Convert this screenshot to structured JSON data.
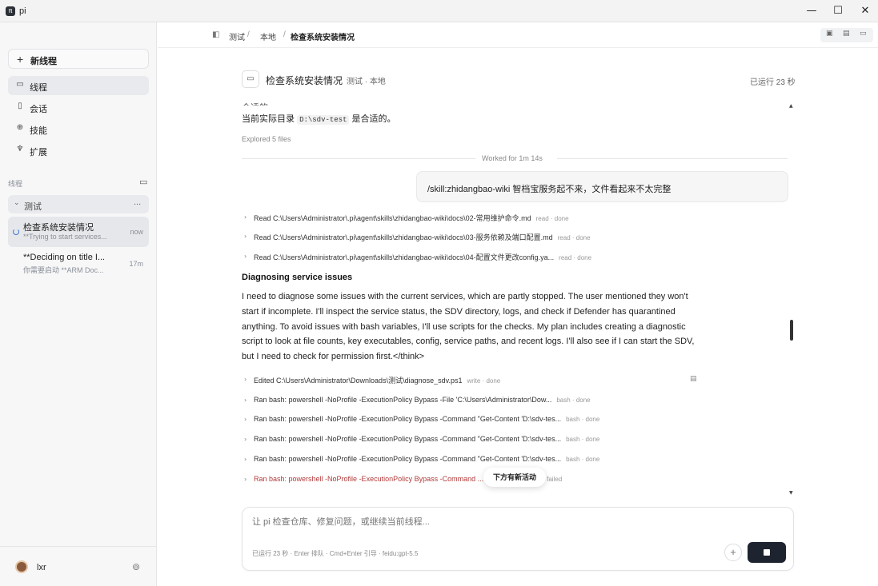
{
  "window": {
    "app_name": "pi",
    "app_icon": "π",
    "minimize": "—",
    "maximize": "☐",
    "close": "✕"
  },
  "sidebar": {
    "new_thread_label": "新线程",
    "nav": [
      {
        "label": "线程",
        "icon": "threads-icon"
      },
      {
        "label": "会话",
        "icon": "sessions-icon"
      },
      {
        "label": "技能",
        "icon": "skills-icon"
      },
      {
        "label": "扩展",
        "icon": "extensions-icon"
      }
    ],
    "section_label": "线程",
    "group": {
      "label": "测试",
      "more": "..."
    },
    "threads": [
      {
        "title": "检查系统安装情况",
        "subtitle": "**Trying to start services...",
        "time": "now"
      },
      {
        "title": "**Deciding on title I...",
        "subtitle": "你需要启动 **ARM Doc...",
        "time": "17m"
      }
    ],
    "user": {
      "name": "lxr"
    }
  },
  "breadcrumb": {
    "items": [
      "测试",
      "本地",
      "检查系统安装情况"
    ],
    "sep": "/"
  },
  "thread_header": {
    "title": "检查系统安装情况",
    "subtitle": "测试 · 本地",
    "elapsed": "已运行 23 秒"
  },
  "content": {
    "cutoff_text": "合适的。",
    "line1_prefix": "当前实际目录",
    "line1_code": "D:\\sdv-test",
    "line1_suffix": "是合适的。",
    "explored": "Explored 5 files",
    "worked_for": "Worked for 1m 14s",
    "user_message": "/skill:zhidangbao-wiki 智档宝服务起不来，文件看起来不太完整",
    "reads": [
      {
        "desc": "Read C:\\Users\\Administrator\\.pi\\agent\\skills\\zhidangbao-wiki\\docs\\02-常用维护命令.md",
        "status": "read · done"
      },
      {
        "desc": "Read C:\\Users\\Administrator\\.pi\\agent\\skills\\zhidangbao-wiki\\docs\\03-服务依赖及端口配置.md",
        "status": "read · done"
      },
      {
        "desc": "Read C:\\Users\\Administrator\\.pi\\agent\\skills\\zhidangbao-wiki\\docs\\04-配置文件更改config.ya...",
        "status": "read · done"
      }
    ],
    "heading": "Diagnosing service issues",
    "paragraph": "I need to diagnose some issues with the current services, which are partly stopped. The user mentioned they won't start if incomplete. I'll inspect the service status, the SDV directory, logs, and check if Defender has quarantined anything. To avoid issues with bash variables, I'll use scripts for the checks. My plan includes creating a diagnostic script to look at file counts, key executables, config, service paths, and recent logs. I'll also see if I can start the SDV, but I need to check for permission first.</think>",
    "actions": [
      {
        "desc": "Edited C:\\Users\\Administrator\\Downloads\\测试\\diagnose_sdv.ps1",
        "status": "write · done",
        "failed": false
      },
      {
        "desc": "Ran bash: powershell -NoProfile -ExecutionPolicy Bypass -File 'C:\\Users\\Administrator\\Dow...",
        "status": "bash · done",
        "failed": false
      },
      {
        "desc": "Ran bash: powershell -NoProfile -ExecutionPolicy Bypass -Command \"Get-Content 'D:\\sdv-tes...",
        "status": "bash · done",
        "failed": false
      },
      {
        "desc": "Ran bash: powershell -NoProfile -ExecutionPolicy Bypass -Command \"Get-Content 'D:\\sdv-tes...",
        "status": "bash · done",
        "failed": false
      },
      {
        "desc": "Ran bash: powershell -NoProfile -ExecutionPolicy Bypass -Command \"Get-Content 'D:\\sdv-tes...",
        "status": "bash · done",
        "failed": false
      },
      {
        "desc": "Ran bash: powershell -NoProfile -ExecutionPolicy Bypass -Command ... Name ela...",
        "status": "bash · failed",
        "failed": true
      }
    ],
    "new_activity": "下方有新活动"
  },
  "composer": {
    "placeholder": "让 pi 检查仓库、修复问题，或继续当前线程...",
    "hint": "已运行 23 秒 · Enter 排队 · Cmd+Enter 引导 · feidu:gpt-5.5",
    "attach": "+"
  },
  "colors": {
    "accent": "#1e2330",
    "failed": "#b23a3a",
    "spinner": "#3a7bd5"
  }
}
